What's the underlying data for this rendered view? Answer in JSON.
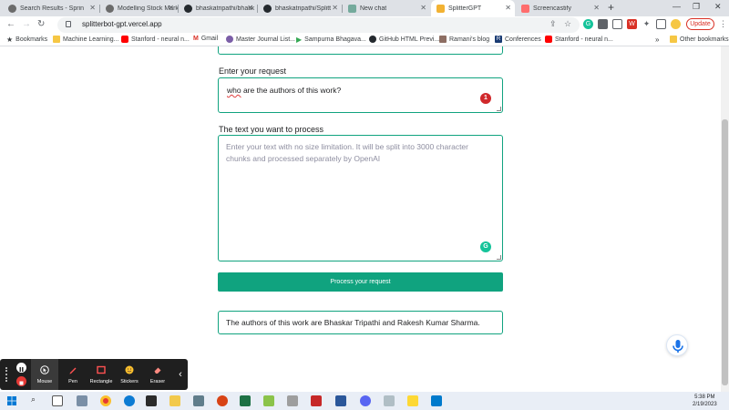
{
  "browser": {
    "tabs": [
      {
        "label": "Search Results - Sprin",
        "active": false
      },
      {
        "label": "Modelling Stock Mark",
        "active": false
      },
      {
        "label": "bhaskatripathi/bhask",
        "active": false
      },
      {
        "label": "bhaskatripathi/Splitt",
        "active": false
      },
      {
        "label": "New chat",
        "active": false
      },
      {
        "label": "SplitterGPT",
        "active": true
      },
      {
        "label": "Screencastify",
        "active": false
      }
    ],
    "url": "splitterbot-gpt.vercel.app",
    "update_label": "Update",
    "bookmarks": [
      "Bookmarks",
      "Machine Learning...",
      "Stanford - neural n...",
      "Gmail",
      "Master Journal List...",
      "Sampurna Bhagava...",
      "GitHub HTML Previ...",
      "Ramani's blog",
      "Conferences",
      "Stanford - neural n..."
    ],
    "other_bookmarks": "Other bookmarks",
    "more_bookmarks": "»"
  },
  "form": {
    "request_label": "Enter your request",
    "request_value": "who are the authors of this work?",
    "request_underlined_word": "who",
    "request_rest": " are the authors of this work?",
    "badge_count": "1",
    "text_label": "The text you want to process",
    "text_placeholder": "Enter your text with no size limitation. It will be split into 3000 character chunks and processed separately by OpenAI",
    "process_button": "Process your request",
    "answer": "The authors of this work are Bhaskar Tripathi and Rakesh Kumar Sharma."
  },
  "screencastify": {
    "tools": [
      "Mouse",
      "Pen",
      "Rectangle",
      "Stickers",
      "Eraser"
    ],
    "active_tool": "Mouse"
  },
  "taskbar": {
    "time": "5:38 PM",
    "date": "2/19/2023"
  },
  "colors": {
    "accent": "#10a37f",
    "badge": "#d0282b",
    "mic": "#1a73e8"
  }
}
